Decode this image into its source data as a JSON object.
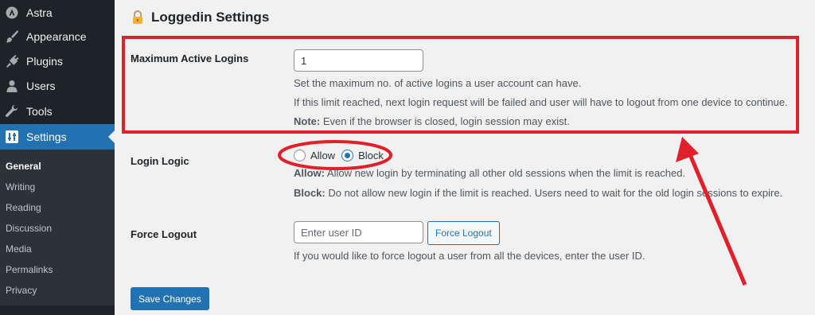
{
  "sidebar": {
    "items": [
      {
        "label": "Astra",
        "icon": "astra-icon"
      },
      {
        "label": "Appearance",
        "icon": "paintbrush-icon"
      },
      {
        "label": "Plugins",
        "icon": "plug-icon"
      },
      {
        "label": "Users",
        "icon": "user-icon"
      },
      {
        "label": "Tools",
        "icon": "wrench-icon"
      },
      {
        "label": "Settings",
        "icon": "settings-icon",
        "active": true
      }
    ],
    "submenu": [
      "General",
      "Writing",
      "Reading",
      "Discussion",
      "Media",
      "Permalinks",
      "Privacy"
    ],
    "current_submenu": "General"
  },
  "page": {
    "title_icon": "lock-icon",
    "title": "Loggedin Settings"
  },
  "max_logins": {
    "label": "Maximum Active Logins",
    "value": "1",
    "desc1": "Set the maximum no. of active logins a user account can have.",
    "desc2": "If this limit reached, next login request will be failed and user will have to logout from one device to continue.",
    "note_prefix": "Note:",
    "note_text": " Even if the browser is closed, login session may exist."
  },
  "login_logic": {
    "label": "Login Logic",
    "options": [
      "Allow",
      "Block"
    ],
    "selected": "Block",
    "allow_prefix": "Allow:",
    "allow_text": " Allow new login by terminating all other old sessions when the limit is reached.",
    "block_prefix": "Block:",
    "block_text": " Do not allow new login if the limit is reached. Users need to wait for the old login sessions to expire."
  },
  "force_logout": {
    "label": "Force Logout",
    "placeholder": "Enter user ID",
    "button_label": "Force Logout",
    "desc": "If you would like to force logout a user from all the devices, enter the user ID."
  },
  "save_button": "Save Changes",
  "colors": {
    "sidebar_bg": "#1d2327",
    "submenu_bg": "#2c3338",
    "accent": "#2271b1",
    "annotation": "#e0202a"
  }
}
